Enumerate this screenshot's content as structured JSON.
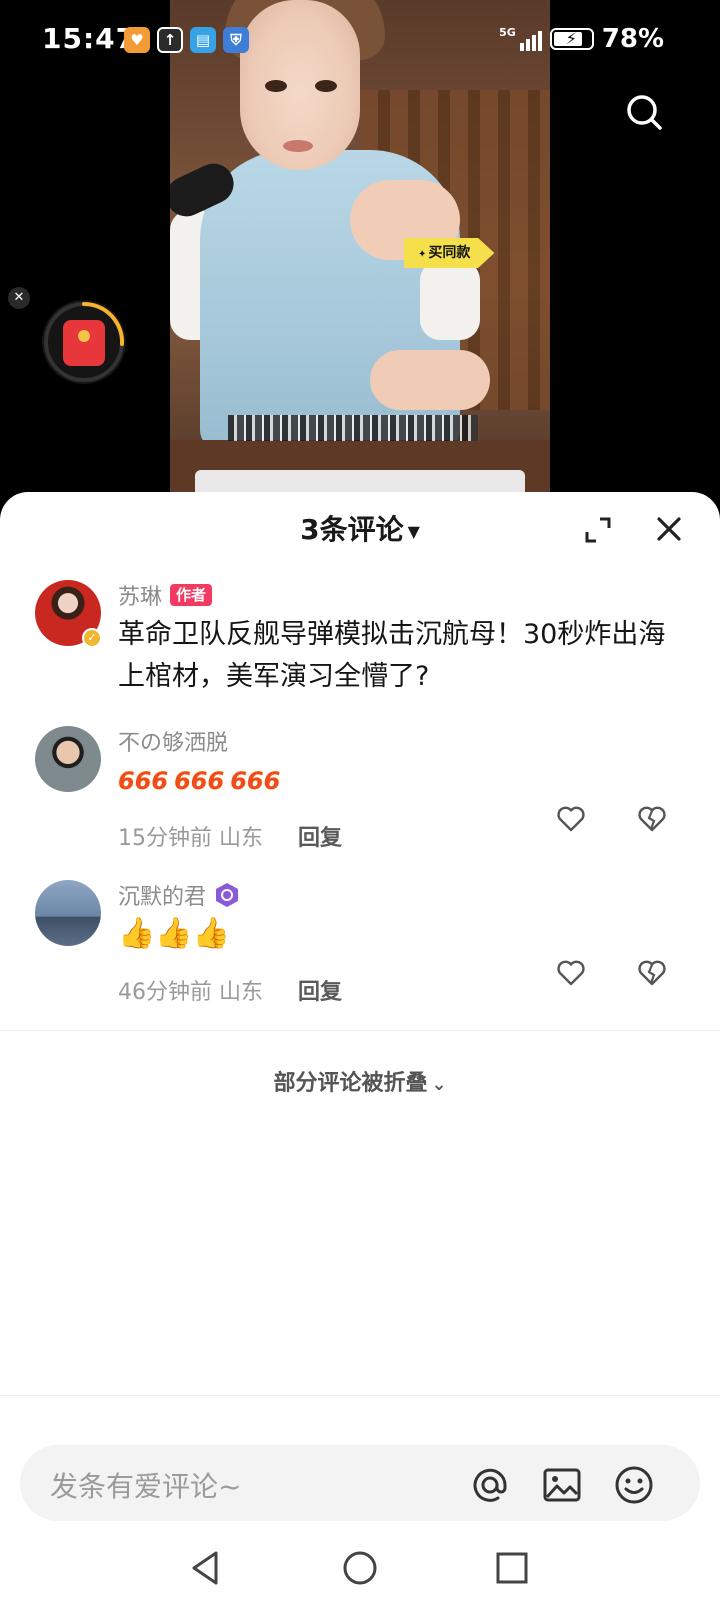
{
  "status_bar": {
    "time": "15:47",
    "network": "5G",
    "battery": "78%",
    "battery_level": 0.78
  },
  "video": {
    "buy_badge": "买同款"
  },
  "comments_sheet": {
    "title": "3条评论",
    "comments": [
      {
        "author": "苏琳",
        "author_tag": "作者",
        "text": "革命卫队反舰导弹模拟击沉航母！30秒炸出海上棺材，美军演习全懵了?"
      },
      {
        "author": "不の够洒脱",
        "emoji_text": "666",
        "time": "15分钟前",
        "location": "山东",
        "reply_label": "回复"
      },
      {
        "author": "沉默的君",
        "emoji_text": "👍👍👍",
        "time": "46分钟前",
        "location": "山东",
        "reply_label": "回复"
      }
    ],
    "folded_label": "部分评论被折叠"
  },
  "input": {
    "placeholder": "发条有爱评论~"
  },
  "icons": {
    "search": "search-icon",
    "expand": "expand-icon",
    "close": "close-icon",
    "like": "heart-icon",
    "dislike": "broken-heart-icon",
    "at": "at-icon",
    "image": "image-icon",
    "emoji": "emoji-icon"
  },
  "colors": {
    "author_tag": "#f23b63",
    "verified": "#f2b632",
    "buy_badge": "#f5e04b",
    "red_packet": "#e8373a"
  }
}
